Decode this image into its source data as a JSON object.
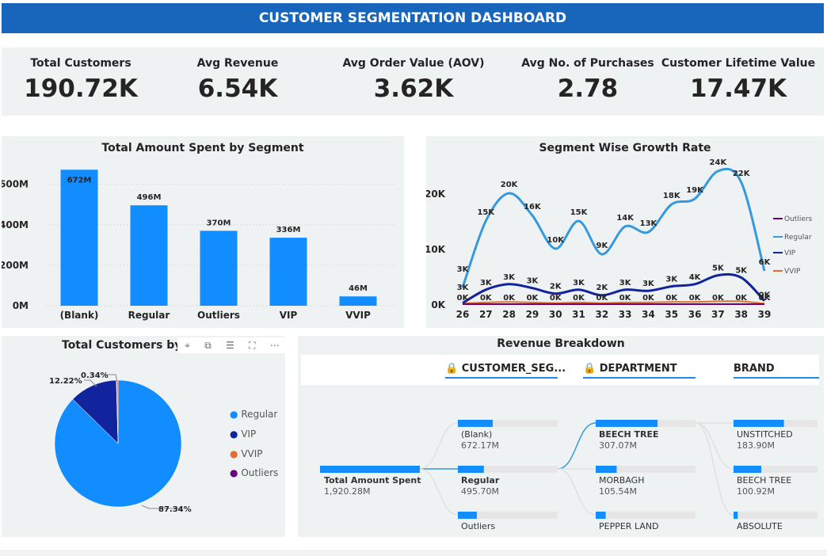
{
  "title": "CUSTOMER SEGMENTATION DASHBOARD",
  "kpis": [
    {
      "label": "Total Customers",
      "value": "190.72K"
    },
    {
      "label": "Avg Revenue",
      "value": "6.54K"
    },
    {
      "label": "Avg Order Value (AOV)",
      "value": "3.62K"
    },
    {
      "label": "Avg No. of Purchases",
      "value": "2.78"
    },
    {
      "label": "Customer Lifetime Value",
      "value": "17.47K"
    }
  ],
  "colors": {
    "blue": "#118dff",
    "navy": "#12239e",
    "orange": "#e66c37",
    "purple": "#6b007b",
    "regular_line": "#3599e0"
  },
  "chart_data": [
    {
      "type": "bar",
      "title": "Total Amount Spent by Segment",
      "categories": [
        "(Blank)",
        "Regular",
        "Outliers",
        "VIP",
        "VVIP"
      ],
      "values": [
        672,
        496,
        370,
        336,
        46
      ],
      "data_labels": [
        "672M",
        "496M",
        "370M",
        "336M",
        "46M"
      ],
      "y_ticks": [
        "0M",
        "200M",
        "400M",
        "600M"
      ],
      "ylim": [
        0,
        720
      ],
      "grid": true
    },
    {
      "type": "line",
      "title": "Segment Wise Growth Rate",
      "x": [
        26,
        27,
        28,
        29,
        30,
        31,
        32,
        33,
        34,
        35,
        36,
        37,
        38,
        39
      ],
      "y_ticks": [
        "0K",
        "10K",
        "20K"
      ],
      "ylim": [
        0,
        25
      ],
      "legend_position": "right",
      "series": [
        {
          "name": "Outliers",
          "values": [
            0,
            0,
            0,
            0,
            0,
            0,
            0,
            0,
            0,
            0,
            0,
            0,
            0,
            0
          ],
          "labels": []
        },
        {
          "name": "Regular",
          "values": [
            3,
            15,
            20,
            16,
            10,
            15,
            9,
            14,
            13,
            18,
            19,
            24,
            22,
            6
          ],
          "labels": [
            "3K",
            "15K",
            "20K",
            "16K",
            "10K",
            "15K",
            "9K",
            "14K",
            "13K",
            "18K",
            "19K",
            "24K",
            "22K",
            "6K"
          ]
        },
        {
          "name": "VIP",
          "values": [
            0.2,
            2.6,
            3.6,
            2.9,
            1.9,
            2.6,
            1.6,
            2.6,
            2.4,
            3.2,
            3.6,
            5.2,
            4.8,
            0.6
          ],
          "labels": [
            "3K",
            "3K",
            "3K",
            "3K",
            "2K",
            "3K",
            "2K",
            "3K",
            "3K",
            "3K",
            "4K",
            "5K",
            "5K",
            "0K"
          ]
        },
        {
          "name": "VVIP",
          "values": [
            0.15,
            0.3,
            0.4,
            0.3,
            0.2,
            0.3,
            0.2,
            0.3,
            0.3,
            0.4,
            0.4,
            0.5,
            0.5,
            0.1
          ],
          "labels": [
            "0K",
            "0K",
            "0K",
            "0K",
            "0K",
            "0K",
            "0K",
            "0K",
            "0K",
            "0K",
            "0K",
            "0K",
            "0K",
            "0K"
          ]
        }
      ]
    },
    {
      "type": "pie",
      "title": "Total Customers by ",
      "series": [
        {
          "name": "Regular",
          "value": 87.34,
          "label": "87.34%"
        },
        {
          "name": "VIP",
          "value": 12.22,
          "label": "12.22%"
        },
        {
          "name": "VVIP",
          "value": 0.34,
          "label": "0.34%"
        },
        {
          "name": "Outliers",
          "value": 0.1,
          "label": ""
        }
      ],
      "legend_position": "right"
    }
  ],
  "toolbar_icons": [
    "pin-icon",
    "copy-icon",
    "filter-icon",
    "focus-icon",
    "more-icon"
  ],
  "toolbar_glyphs": [
    "⌖",
    "⧉",
    "☰",
    "⛶",
    "⋯"
  ],
  "decomposition": {
    "title": "Revenue Breakdown",
    "headers": [
      "CUSTOMER_SEG...",
      "DEPARTMENT",
      "BRAND"
    ],
    "root": {
      "label": "Total Amount Spent",
      "value": "1,920.28M"
    },
    "segments": [
      {
        "label": "(Blank)",
        "value": "672.17M",
        "fill": 0.35
      },
      {
        "label": "Regular",
        "value": "495.70M",
        "fill": 0.26
      },
      {
        "label": "Outliers",
        "value": "",
        "fill": 0.19
      }
    ],
    "departments": [
      {
        "label": "BEECH TREE",
        "value": "307.07M",
        "fill": 0.62
      },
      {
        "label": "MORBAGH",
        "value": "105.54M",
        "fill": 0.21
      },
      {
        "label": "PEPPER LAND",
        "value": "",
        "fill": 0.1
      }
    ],
    "brands": [
      {
        "label": "UNSTITCHED",
        "value": "183.90M",
        "fill": 0.6
      },
      {
        "label": "BEECH TREE",
        "value": "100.92M",
        "fill": 0.33
      },
      {
        "label": "ABSOLUTE",
        "value": "",
        "fill": 0.05
      }
    ]
  }
}
